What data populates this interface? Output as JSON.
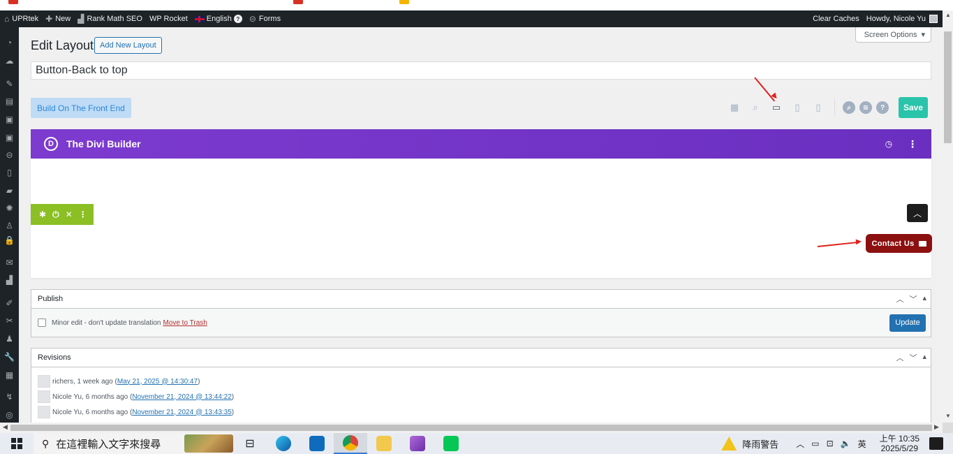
{
  "adminbar": {
    "site": "UPRtek",
    "new": "New",
    "rankmath": "Rank Math SEO",
    "wprocket": "WP Rocket",
    "language": "English",
    "lang_badge": "?",
    "forms": "Forms",
    "clear_caches": "Clear Caches",
    "howdy": "Howdy, Nicole Yu"
  },
  "screen_options": "Screen Options",
  "page": {
    "title": "Edit Layout",
    "add_new": "Add New Layout",
    "layout_title": "Button-Back to top"
  },
  "builder": {
    "front_end_btn": "Build On The Front End",
    "save": "Save",
    "divi_logo": "D",
    "divi_title": "The Divi Builder",
    "contact_label": "Contact Us"
  },
  "publish": {
    "title": "Publish",
    "minor_edit": "Minor edit - don't update translation",
    "trash": "Move to Trash",
    "update": "Update"
  },
  "revisions": {
    "title": "Revisions",
    "items": [
      {
        "author": "richers, 1 week ago (",
        "date": "May 21, 2025 @ 14:30:47",
        "close": ")"
      },
      {
        "author": "Nicole Yu, 6 months ago (",
        "date": "November 21, 2024 @ 13:44:22",
        "close": ")"
      },
      {
        "author": "Nicole Yu, 6 months ago (",
        "date": "November 21, 2024 @ 13:43:35",
        "close": ")"
      }
    ]
  },
  "taskbar": {
    "search_placeholder": "在這裡輸入文字來搜尋",
    "weather": "降雨警告",
    "ime": "英",
    "time": "上午 10:35",
    "date": "2025/5/29"
  },
  "colors": {
    "divi_purple": "#7e3bd0",
    "save_green": "#29c4a9",
    "contact_red": "#8c1010",
    "wp_blue": "#2271b1",
    "annotation_red": "#e0201a"
  }
}
